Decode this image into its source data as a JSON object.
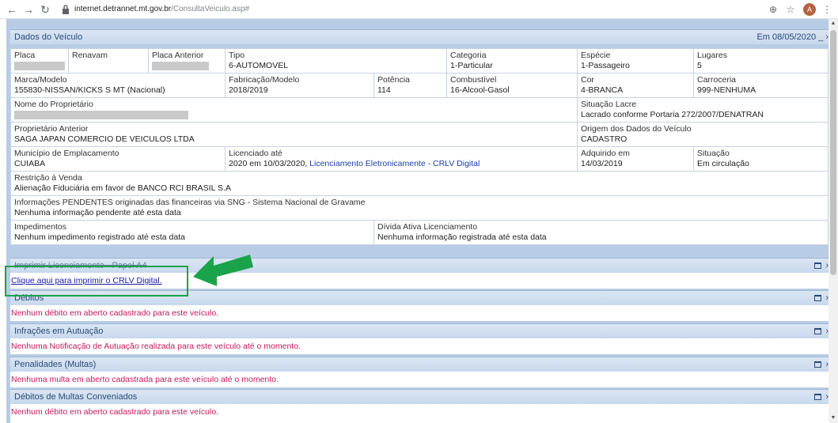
{
  "browser": {
    "url_host": "internet.detrannet.mt.gov.br",
    "url_path": "/ConsultaVeiculo.asp#",
    "avatar_letter": "A"
  },
  "header": {
    "title": "Dados do Veículo",
    "date": "Em 08/05/2020"
  },
  "vehicle": {
    "placa_label": "Placa",
    "renavam_label": "Renavam",
    "placa_anterior_label": "Placa Anterior",
    "tipo_label": "Tipo",
    "tipo_value": "6-AUTOMOVEL",
    "categoria_label": "Categoria",
    "categoria_value": "1-Particular",
    "especie_label": "Espécie",
    "especie_value": "1-Passageiro",
    "lugares_label": "Lugares",
    "lugares_value": "5",
    "marca_label": "Marca/Modelo",
    "marca_value": "155830-NISSAN/KICKS S MT (Nacional)",
    "fabricacao_label": "Fabricação/Modelo",
    "fabricacao_value": "2018/2019",
    "potencia_label": "Potência",
    "potencia_value": "114",
    "combustivel_label": "Combustível",
    "combustivel_value": "16-Alcool-Gasol",
    "cor_label": "Cor",
    "cor_value": "4-BRANCA",
    "carroceria_label": "Carroceria",
    "carroceria_value": "999-NENHUMA",
    "proprietario_label": "Nome do Proprietário",
    "lacre_label": "Situação Lacre",
    "lacre_value": "Lacrado conforme Portaria 272/2007/DENATRAN",
    "prop_anterior_label": "Proprietário Anterior",
    "prop_anterior_value": "SAGA JAPAN COMERCIO DE VEICULOS LTDA",
    "origem_label": "Origem dos Dados do Veículo",
    "origem_value": "CADASTRO",
    "municipio_label": "Município de Emplacamento",
    "municipio_value": "CUIABA",
    "licenciado_label": "Licenciado até",
    "licenciado_value": "2020 em 10/03/2020,",
    "licenciado_link": "Licenciamento Eletronicamente - CRLV Digital",
    "adquirido_label": "Adquirido em",
    "adquirido_value": "14/03/2019",
    "situacao_label": "Situação",
    "situacao_value": "Em circulação",
    "restricao_label": "Restrição à Venda",
    "restricao_value": "Alienação Fiduciária em favor de BANCO RCI BRASIL S.A",
    "sng_label": "Informações PENDENTES originadas das financeiras via SNG - Sistema Nacional de Gravame",
    "sng_value": "Nenhuma informação pendente até esta data",
    "impedimentos_label": "Impedimentos",
    "impedimentos_value": "Nenhum impedimento registrado até esta data",
    "divida_label": "Dívida Ativa Licenciamento",
    "divida_value": "Nenhuma informação registrada até esta data"
  },
  "sections": {
    "imprimir_title": "Imprimir Licenciamento - Papel A4",
    "imprimir_link": "Clique aqui para imprimir o CRLV Digital.",
    "debitos_title": "Débitos",
    "debitos_body": "Nenhum débito em aberto cadastrado para este veículo.",
    "infracoes_title": "Infrações em Autuação",
    "infracoes_body": "Nenhuma Notificação de Autuação realizada para este veículo até o momento.",
    "penalidades_title": "Penalidades (Multas)",
    "penalidades_body": "Nenhuma multa em aberto cadastrada para este veículo até o momento.",
    "conveniados_title": "Débitos de Multas Conveniados",
    "conveniados_body": "Nenhum débito em aberto cadastrado para este veículo."
  },
  "colors": {
    "highlight_box": "#1aa34a",
    "arrow": "#1aa34a",
    "notice_text": "#c2185b"
  }
}
